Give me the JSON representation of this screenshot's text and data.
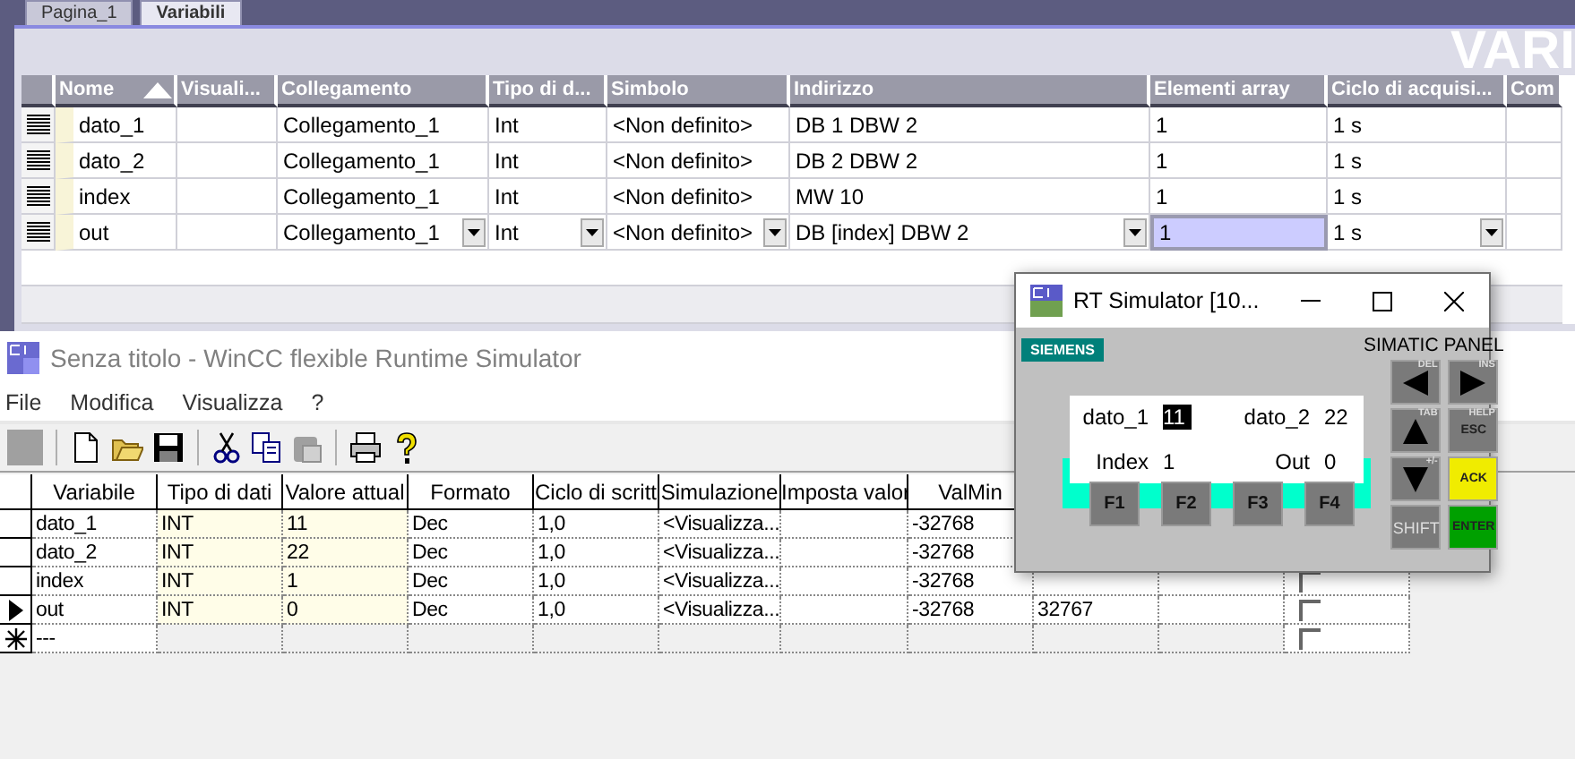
{
  "editor": {
    "tabs": [
      {
        "label": "Pagina_1",
        "selected": false
      },
      {
        "label": "Variabili",
        "selected": true
      }
    ],
    "heading": "VARI",
    "columns": [
      {
        "label": "Nome",
        "kind": "text",
        "sort_ascending": true
      },
      {
        "label": "Visuali...",
        "kind": "text"
      },
      {
        "label": "Collegamento",
        "kind": "combo"
      },
      {
        "label": "Tipo di d...",
        "kind": "combo"
      },
      {
        "label": "Simbolo",
        "kind": "combo"
      },
      {
        "label": "Indirizzo",
        "kind": "combo"
      },
      {
        "label": "Elementi array",
        "kind": "number"
      },
      {
        "label": "Ciclo di acquisi...",
        "kind": "combo"
      },
      {
        "label": "Com",
        "kind": "text"
      }
    ],
    "rows": [
      {
        "cells": [
          "dato_1",
          "",
          "Collegamento_1",
          "Int",
          "<Non definito>",
          "DB 1 DBW 2",
          "1",
          "1 s",
          ""
        ],
        "editing": false
      },
      {
        "cells": [
          "dato_2",
          "",
          "Collegamento_1",
          "Int",
          "<Non definito>",
          "DB 2 DBW 2",
          "1",
          "1 s",
          ""
        ],
        "editing": false
      },
      {
        "cells": [
          "index",
          "",
          "Collegamento_1",
          "Int",
          "<Non definito>",
          "MW 10",
          "1",
          "1 s",
          ""
        ],
        "editing": false
      },
      {
        "cells": [
          "out",
          "",
          "Collegamento_1",
          "Int",
          "<Non definito>",
          "DB [index] DBW 2",
          "1",
          "1 s",
          ""
        ],
        "editing": true
      }
    ]
  },
  "runtime": {
    "title": "Senza titolo - WinCC flexible Runtime Simulator",
    "active": false,
    "menu": [
      "File",
      "Modifica",
      "Visualizza",
      "?"
    ],
    "columns": [
      "Variabile",
      "Tipo di dati",
      "Valore attual",
      "Formato",
      "Ciclo di scritt",
      "Simulazione",
      "Imposta valor",
      "ValMin"
    ],
    "rows": [
      {
        "kind": "normal",
        "cells": [
          "dato_1",
          "INT",
          "11",
          "Dec",
          "1,0",
          "<Visualizza...",
          "",
          "-32768",
          "",
          ""
        ]
      },
      {
        "kind": "normal",
        "cells": [
          "dato_2",
          "INT",
          "22",
          "Dec",
          "1,0",
          "<Visualizza...",
          "",
          "-32768",
          "",
          ""
        ]
      },
      {
        "kind": "normal",
        "cells": [
          "index",
          "INT",
          "1",
          "Dec",
          "1,0",
          "<Visualizza...",
          "",
          "-32768",
          "",
          ""
        ],
        "checked": false
      },
      {
        "kind": "current",
        "cells": [
          "out",
          "INT",
          "0",
          "Dec",
          "1,0",
          "<Visualizza...",
          "",
          "-32768",
          "32767",
          ""
        ],
        "checked": false
      },
      {
        "kind": "new",
        "cells": [
          "---",
          "",
          "",
          "",
          "",
          "",
          "",
          "",
          "",
          ""
        ],
        "checked": false
      }
    ]
  },
  "simulator": {
    "title": "RT Simulator [10...",
    "brand": "SIEMENS",
    "model": "SIMATIC PANEL",
    "fields": [
      {
        "label": "dato_1",
        "value": "11",
        "selected": true
      },
      {
        "label": "dato_2",
        "value": "22",
        "selected": false
      },
      {
        "label": "Index",
        "value": "1",
        "selected": false
      },
      {
        "label": "Out",
        "value": "0",
        "selected": false
      }
    ],
    "function_keys": [
      "F1",
      "F2",
      "F3",
      "F4"
    ],
    "keys": [
      {
        "kind": "arrow-left",
        "hint": "DEL",
        "color": "#7a7a7a"
      },
      {
        "kind": "arrow-right",
        "hint": "INS",
        "color": "#7a7a7a"
      },
      {
        "kind": "arrow-up",
        "hint": "TAB",
        "color": "#7a7a7a"
      },
      {
        "kind": "text",
        "label": "ESC",
        "hint": "HELP",
        "color": "#7a7a7a"
      },
      {
        "kind": "arrow-down",
        "hint": "+/-",
        "color": "#7a7a7a"
      },
      {
        "kind": "text",
        "label": "ACK",
        "color": "#f0ec00"
      },
      {
        "kind": "text",
        "label": "SHIFT",
        "color": "#7a7a7a"
      },
      {
        "kind": "text",
        "label": "ENTER",
        "color": "#00a000"
      }
    ]
  }
}
